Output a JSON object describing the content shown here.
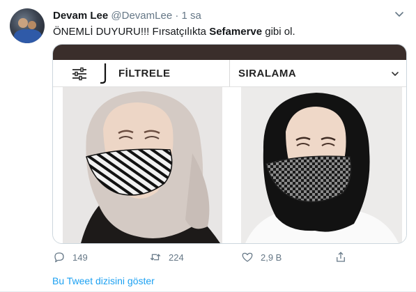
{
  "tweet": {
    "author_name": "Devam Lee",
    "handle": "@DevamLee",
    "separator": "·",
    "time": "1 sa",
    "text_before": "ÖNEMLİ DUYURU!!! Fırsatçılıkta ",
    "text_bold": "Sefamerve",
    "text_after": " gibi ol."
  },
  "media": {
    "filter_label": "FİLTRELE",
    "sort_label": "SIRALAMA",
    "colors": {
      "top_bar": "#3a2e2b",
      "left_hijab": "#d2c8c2",
      "right_hijab": "#141414"
    }
  },
  "actions": {
    "reply_count": "149",
    "retweet_count": "224",
    "like_count": "2,9 B"
  },
  "show_thread_link": "Bu Tweet dizisini göster",
  "icons": {
    "reply": "reply-icon",
    "retweet": "retweet-icon",
    "like": "heart-icon",
    "share": "share-icon",
    "more": "chevron-down-icon",
    "filter": "filter-sliders-icon"
  }
}
